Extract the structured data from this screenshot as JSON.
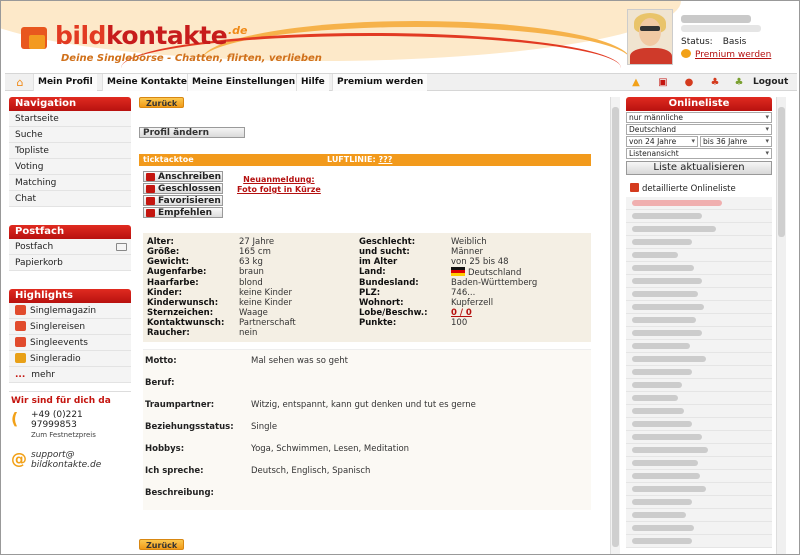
{
  "header": {
    "logo_part1": "bild",
    "logo_part2": "kontakte",
    "logo_domain": ".de",
    "slogan": "Deine Singlebörse - Chatten, flirten, verlieben",
    "status_label": "Status:",
    "status_value": "Basis",
    "premium_link": "Premium werden"
  },
  "nav": {
    "items": [
      "Mein Profil",
      "Meine Kontakte",
      "Meine Einstellungen",
      "Hilfe",
      "Premium werden"
    ],
    "logout": "Logout"
  },
  "sidebar": {
    "navigation_title": "Navigation",
    "navigation_items": [
      "Startseite",
      "Suche",
      "Topliste",
      "Voting",
      "Matching",
      "Chat"
    ],
    "postfach_title": "Postfach",
    "postfach_items": [
      "Postfach",
      "Papierkorb"
    ],
    "highlights_title": "Highlights",
    "highlights_items": [
      "Singlemagazin",
      "Singlereisen",
      "Singleevents",
      "Singleradio"
    ],
    "more_dots": "...",
    "more_label": "mehr",
    "contact_title": "Wir sind für dich da",
    "phone": "+49 (0)221 97999853",
    "phone_note": "Zum Festnetzpreis",
    "email_line1": "support@",
    "email_line2": "bildkontakte.de"
  },
  "main": {
    "back_label": "Zurück",
    "edit_profile": "Profil ändern",
    "username": "ticktacktoe",
    "luftlinie_label": "LUFTLINIE:",
    "luftlinie_value": "???",
    "actions": [
      "Anschreiben",
      "Geschlossen",
      "Favorisieren",
      "Empfehlen"
    ],
    "notice_line1": "Neuanmeldung:",
    "notice_line2": "Foto folgt in Kürze",
    "details": {
      "left": [
        [
          "Alter:",
          "27 Jahre"
        ],
        [
          "Größe:",
          "165 cm"
        ],
        [
          "Gewicht:",
          "63 kg"
        ],
        [
          "Augenfarbe:",
          "braun"
        ],
        [
          "Haarfarbe:",
          "blond"
        ],
        [
          "Kinder:",
          "keine Kinder"
        ],
        [
          "Kinderwunsch:",
          "keine Kinder"
        ],
        [
          "Sternzeichen:",
          "Waage"
        ],
        [
          "Kontaktwunsch:",
          "Partnerschaft"
        ],
        [
          "Raucher:",
          "nein"
        ]
      ],
      "right": [
        [
          "Geschlecht:",
          "Weiblich"
        ],
        [
          "und sucht:",
          "Männer"
        ],
        [
          "im Alter",
          "von 25 bis 48"
        ],
        [
          "Land:",
          "Deutschland"
        ],
        [
          "Bundesland:",
          "Baden-Württemberg"
        ],
        [
          "PLZ:",
          "746..."
        ],
        [
          "Wohnort:",
          "Kupferzell"
        ],
        [
          "Lobe/Beschw.:",
          "0 / 0"
        ],
        [
          "Punkte:",
          "100"
        ],
        [
          "",
          ""
        ]
      ]
    },
    "qa": [
      [
        "Motto:",
        "Mal sehen was so geht"
      ],
      [
        "Beruf:",
        ""
      ],
      [
        "Traumpartner:",
        "Witzig, entspannt, kann gut denken und tut es gerne"
      ],
      [
        "Beziehungsstatus:",
        "Single"
      ],
      [
        "Hobbys:",
        "Yoga, Schwimmen, Lesen, Meditation"
      ],
      [
        "Ich spreche:",
        "Deutsch, Englisch, Spanisch"
      ],
      [
        "Beschreibung:",
        ""
      ]
    ]
  },
  "online": {
    "title": "Onlineliste",
    "filter_gender": "nur männliche",
    "filter_country": "Deutschland",
    "filter_age_from": "von 24 Jahre",
    "filter_age_to": "bis 36 Jahre",
    "filter_view": "Listenansicht",
    "refresh": "Liste aktualisieren",
    "detailed_link": "detaillierte Onlineliste"
  },
  "colors": {
    "brand_red": "#c4150f",
    "brand_orange": "#f29a1c"
  }
}
